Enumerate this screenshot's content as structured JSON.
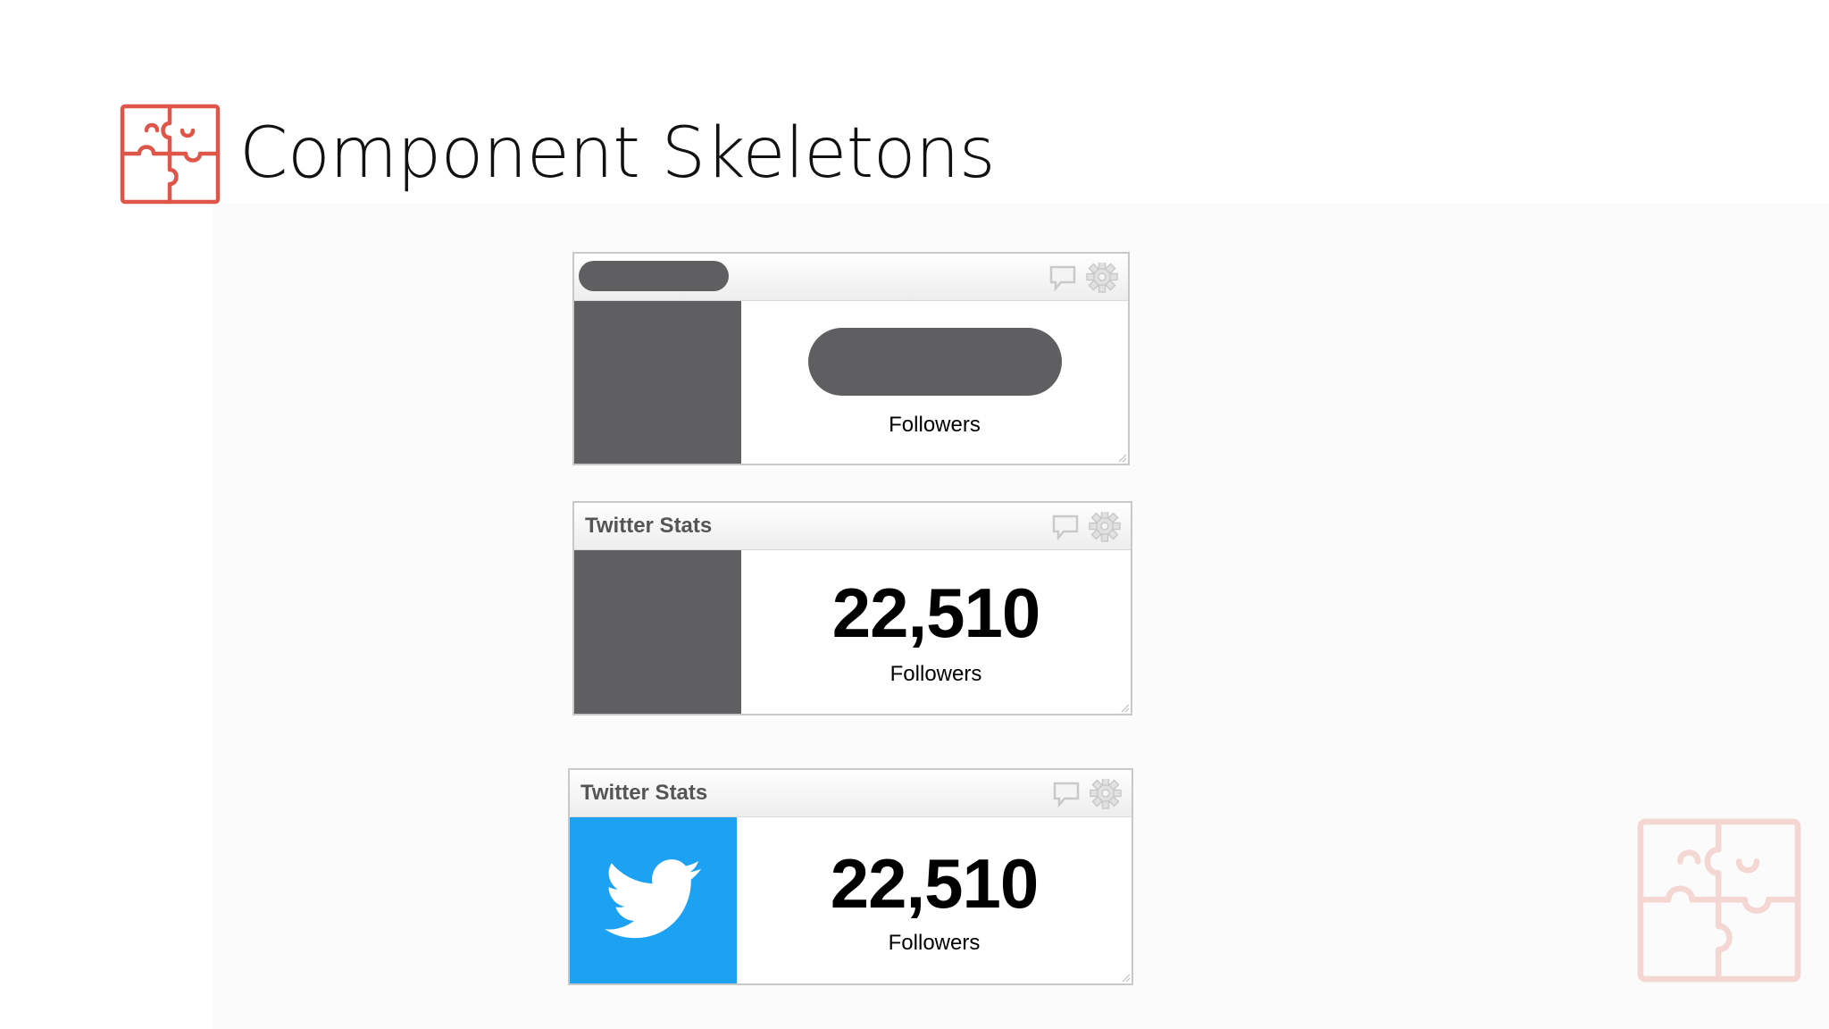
{
  "slide": {
    "title": "Component Skeletons",
    "title_icon": "puzzle-icon",
    "watermark_icon": "puzzle-icon"
  },
  "colors": {
    "accent": "#e0554a",
    "skeleton": "#5f5e61",
    "twitter_blue": "#1da1f2",
    "header_text": "#555555"
  },
  "widgets": [
    {
      "state": "skeleton",
      "title": "",
      "value": "",
      "label": "Followers",
      "header_icons": [
        "comment-icon",
        "gear-icon"
      ]
    },
    {
      "state": "data-loaded",
      "title": "Twitter Stats",
      "value": "22,510",
      "label": "Followers",
      "header_icons": [
        "comment-icon",
        "gear-icon"
      ]
    },
    {
      "state": "complete",
      "title": "Twitter Stats",
      "value": "22,510",
      "label": "Followers",
      "image_icon": "twitter-bird-icon",
      "header_icons": [
        "comment-icon",
        "gear-icon"
      ]
    }
  ]
}
